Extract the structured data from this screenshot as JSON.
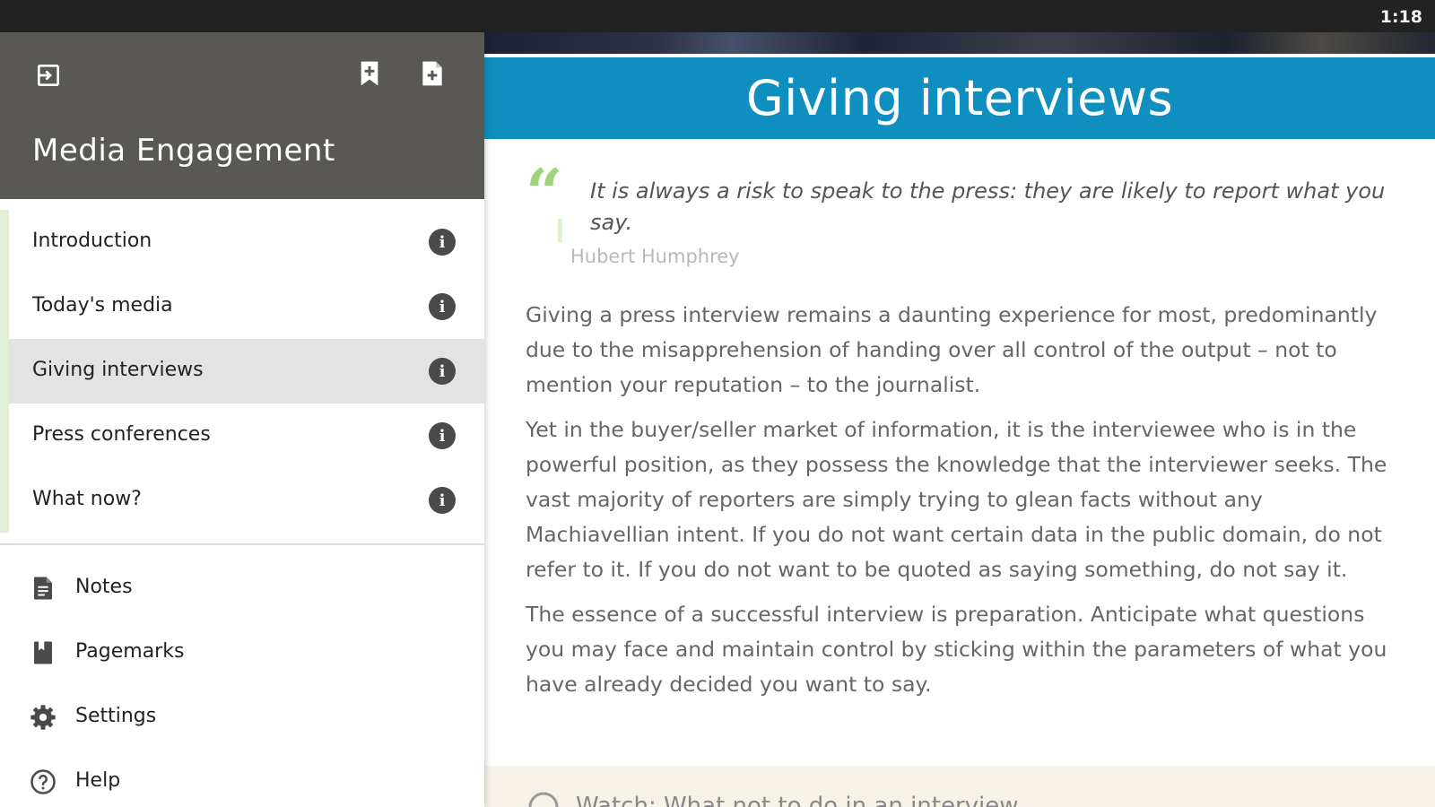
{
  "status_bar": {
    "time": "1:18"
  },
  "drawer": {
    "title": "Media Engagement",
    "header_icons": [
      "exit-icon",
      "add-bookmark-icon",
      "add-note-icon"
    ],
    "chapters": [
      {
        "label": "Introduction",
        "active": false
      },
      {
        "label": "Today's media",
        "active": false
      },
      {
        "label": "Giving interviews",
        "active": true
      },
      {
        "label": "Press conferences",
        "active": false
      },
      {
        "label": "What now?",
        "active": false
      }
    ],
    "chapter_info_glyph": "i",
    "menu": [
      {
        "label": "Notes",
        "icon": "notes-icon"
      },
      {
        "label": "Pagemarks",
        "icon": "pagemarks-icon"
      },
      {
        "label": "Settings",
        "icon": "settings-icon"
      },
      {
        "label": "Help",
        "icon": "help-icon"
      }
    ]
  },
  "main": {
    "title": "Giving interviews",
    "quote": {
      "mark": "“",
      "text": "It is always a risk to speak to the press: they are likely to report what you say.",
      "author": "Hubert Humphrey"
    },
    "paragraphs": [
      "Giving a press interview remains a daunting experience for most, predominantly due to the misapprehension of handing over all control of the output – not to mention your reputation – to the journalist.",
      "Yet in the buyer/seller market of information, it is the interviewee who is in the powerful position, as they possess the knowledge that the interviewer seeks. The vast majority of reporters are simply trying to glean facts without any Machiavellian intent. If you do not want certain data in the public domain, do not refer to it. If you do not want to be quoted as saying something, do not say it.",
      "The essence of a successful interview is preparation. Anticipate what questions you may face and maintain control by sticking within the parameters of what you have already decided you want to say."
    ],
    "watch_label": "Watch: What not to do in an interview"
  },
  "colors": {
    "drawer_header": "#5a5855",
    "title_bar": "#0f8fc0",
    "quote_mark": "#9fd47e",
    "active_chapter": "#e3e3e3",
    "chapter_accent": "#e1f0d4"
  }
}
